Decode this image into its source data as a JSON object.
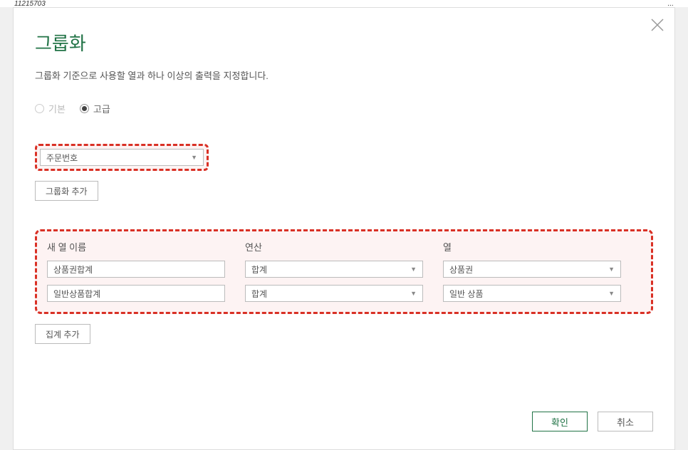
{
  "header": {
    "left": "11215703",
    "right": "..."
  },
  "dialog": {
    "title": "그룹화",
    "subtitle": "그룹화 기준으로 사용할 열과 하나 이상의 출력을 지정합니다.",
    "radio": {
      "basic": "기본",
      "advanced": "고급"
    },
    "groupby": {
      "selected": "주문번호",
      "add_button": "그룹화 추가"
    },
    "agg": {
      "headers": {
        "newcol": "새 열 이름",
        "op": "연산",
        "col": "열"
      },
      "rows": [
        {
          "name": "상품권합계",
          "op": "합계",
          "col": "상품권"
        },
        {
          "name": "일반상품합계",
          "op": "합계",
          "col": "일반 상품"
        }
      ],
      "add_button": "집계 추가"
    },
    "footer": {
      "ok": "확인",
      "cancel": "취소"
    }
  }
}
